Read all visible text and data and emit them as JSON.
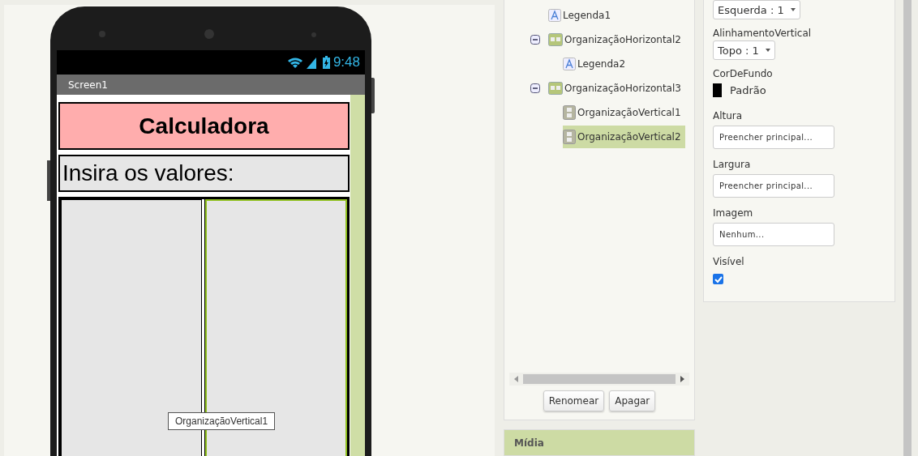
{
  "phone": {
    "status_time": "9:48",
    "screen_title": "Screen1",
    "components": [
      {
        "kind": "title",
        "text": "Calculadora"
      },
      {
        "kind": "label",
        "text": "Insira os valores:"
      },
      {
        "kind": "horizontal",
        "children": [
          {
            "kind": "vertical",
            "selected": false
          },
          {
            "kind": "vertical",
            "selected": true
          }
        ]
      }
    ],
    "tooltip": "OrganizaçãoVertical1"
  },
  "tree": {
    "items": [
      {
        "kind": "label",
        "name": "Legenda1",
        "selected": false
      },
      {
        "kind": "horizontal",
        "name": "OrganizaçãoHorizontal2",
        "expanded": true,
        "selected": false,
        "children": [
          {
            "kind": "label",
            "name": "Legenda2",
            "selected": false
          }
        ]
      },
      {
        "kind": "horizontal",
        "name": "OrganizaçãoHorizontal3",
        "expanded": true,
        "selected": false,
        "children": [
          {
            "kind": "vertical",
            "name": "OrganizaçãoVertical1",
            "selected": false
          },
          {
            "kind": "vertical",
            "name": "OrganizaçãoVertical2",
            "selected": true
          }
        ]
      }
    ],
    "buttons": [
      "Renomear",
      "Apagar"
    ]
  },
  "media_header": "Mídia",
  "properties": [
    {
      "kind": "dropdown",
      "value": "Esquerda : 1"
    },
    {
      "kind": "dropdown",
      "label": "AlinhamentoVertical",
      "value": "Topo : 1"
    },
    {
      "kind": "color",
      "label": "CorDeFundo",
      "value": "Padrão",
      "color": "#000000"
    },
    {
      "kind": "text",
      "label": "Altura",
      "value": "Preencher principal..."
    },
    {
      "kind": "text",
      "label": "Largura",
      "value": "Preencher principal..."
    },
    {
      "kind": "text",
      "label": "Imagem",
      "value": "Nenhum..."
    },
    {
      "kind": "checkbox",
      "label": "Visível",
      "checked": true
    }
  ]
}
